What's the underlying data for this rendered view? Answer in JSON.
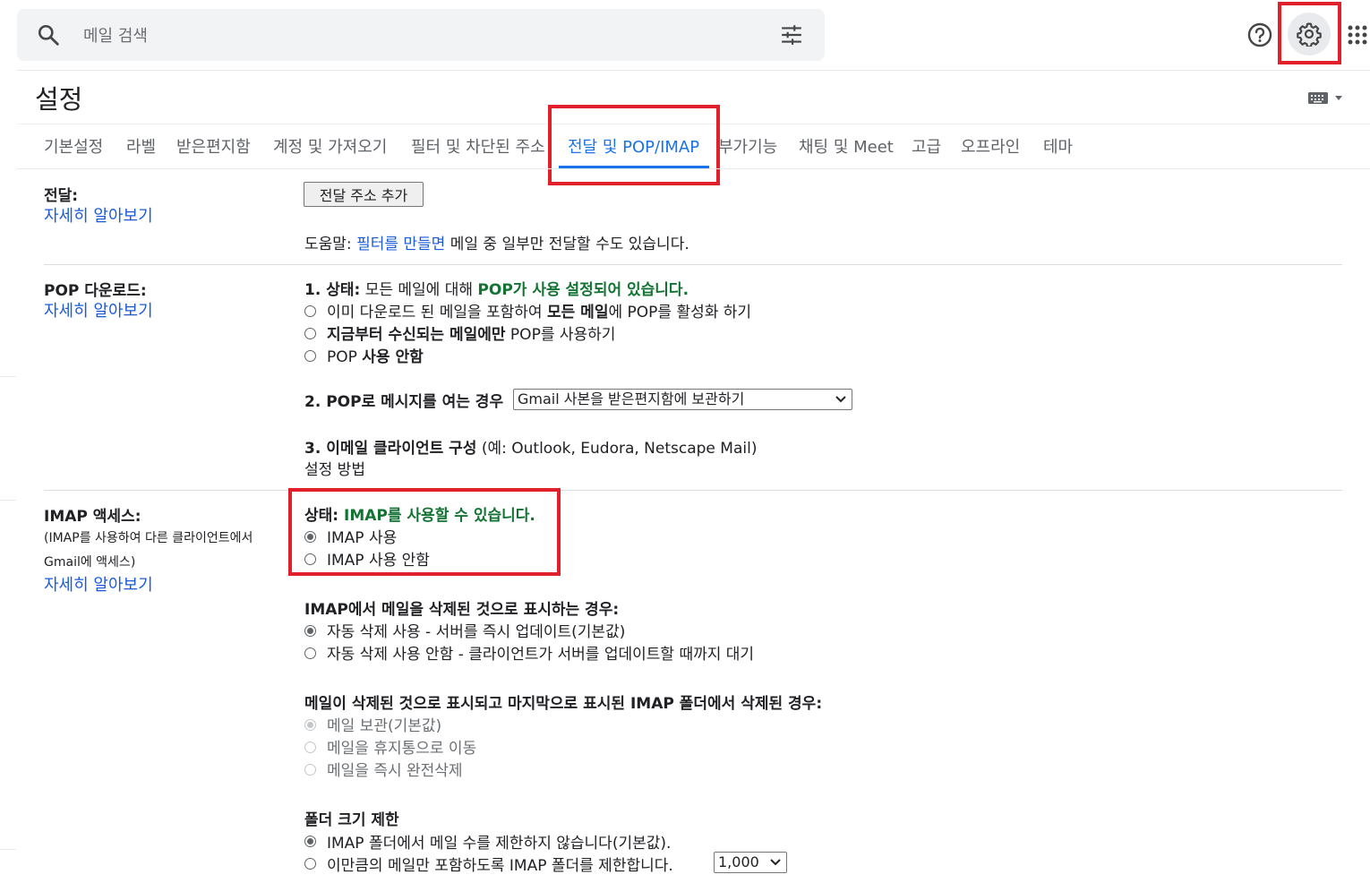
{
  "search": {
    "placeholder": "메일 검색"
  },
  "settings": {
    "title": "설정"
  },
  "tabs": [
    {
      "label": "기본설정"
    },
    {
      "label": "라벨"
    },
    {
      "label": "받은편지함"
    },
    {
      "label": "계정 및 가져오기"
    },
    {
      "label": "필터 및 차단된 주소"
    },
    {
      "label": "전달 및 POP/IMAP"
    },
    {
      "label": "부가기능"
    },
    {
      "label": "채팅 및 Meet"
    },
    {
      "label": "고급"
    },
    {
      "label": "오프라인"
    },
    {
      "label": "테마"
    }
  ],
  "forwarding": {
    "label": "전달:",
    "learn_more": "자세히 알아보기",
    "add_button": "전달 주소 추가",
    "tip_prefix": "도움말: ",
    "tip_link": "필터를 만들면",
    "tip_suffix": " 메일 중 일부만 전달할 수도 있습니다."
  },
  "pop": {
    "label": "POP 다운로드:",
    "learn_more": "자세히 알아보기",
    "status_prefix": "1. 상태:",
    "status_mid": " 모든 메일에 대해 ",
    "status_value": "POP가 사용 설정되어 있습니다.",
    "opt1_a": "이미 다운로드 된 메일을 포함하여 ",
    "opt1_b": "모든 메일",
    "opt1_c": "에 POP를 활성화 하기",
    "opt2_a": "지금부터 수신되는 메일에만",
    "opt2_b": " POP를 사용하기",
    "opt3_a": "POP ",
    "opt3_b": "사용 안함",
    "when_label": "2. POP로 메시지를 여는 경우",
    "when_select": "Gmail 사본을 받은편지함에 보관하기",
    "client_label": "3. 이메일 클라이언트 구성",
    "client_example": " (예: Outlook, Eudora, Netscape Mail)",
    "setup_link": "설정 방법"
  },
  "imap": {
    "label": "IMAP 액세스:",
    "sub1": "(IMAP를 사용하여 다른 클라이언트에서",
    "sub2": "Gmail에 액세스)",
    "learn_more": "자세히 알아보기",
    "status_prefix": "상태: ",
    "status_value": "IMAP를 사용할 수 있습니다.",
    "enable": "IMAP 사용",
    "disable": "IMAP 사용 안함",
    "delete_heading": "IMAP에서 메일을 삭제된 것으로 표시하는 경우:",
    "auto_on": "자동 삭제 사용 - 서버를 즉시 업데이트(기본값)",
    "auto_off": "자동 삭제 사용 안함 - 클라이언트가 서버를 업데이트할 때까지 대기",
    "expunge_heading": "메일이 삭제된 것으로 표시되고 마지막으로 표시된 IMAP 폴더에서 삭제된 경우:",
    "archive": "메일 보관(기본값)",
    "trash": "메일을 휴지통으로 이동",
    "delete_forever": "메일을 즉시 완전삭제",
    "folder_heading": "폴더 크기 제한",
    "no_limit": "IMAP 폴더에서 메일 수를 제한하지 않습니다(기본값).",
    "limit": "이만큼의 메일만 포함하도록 IMAP 폴더를 제한합니다.",
    "limit_select": "1,000"
  },
  "colors": {
    "accent": "#1a73e8",
    "link": "#1a5ad7",
    "success": "#137333",
    "highlight": "#e2202c"
  }
}
